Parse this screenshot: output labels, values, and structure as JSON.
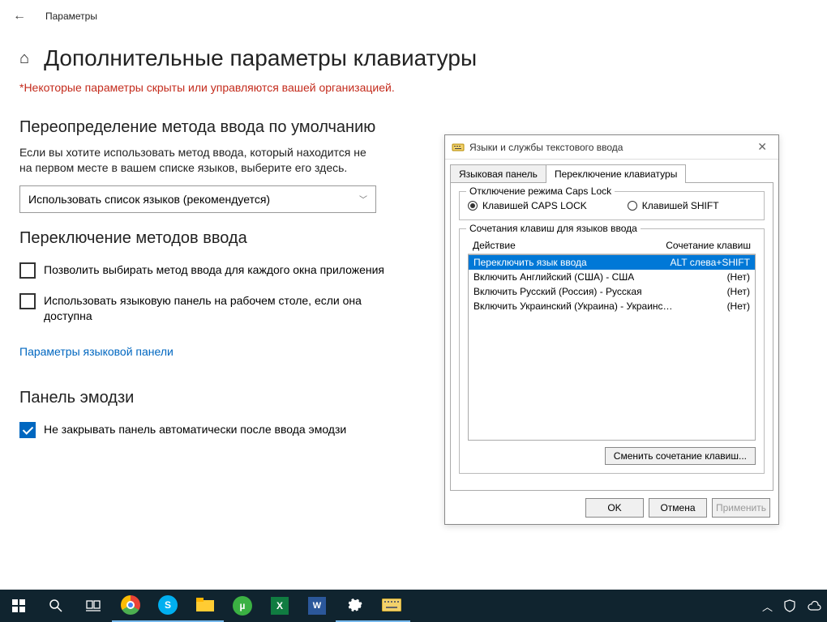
{
  "topbar": {
    "back": "←",
    "title": "Параметры"
  },
  "page": {
    "title": "Дополнительные параметры клавиатуры",
    "warning": "*Некоторые параметры скрыты или управляются вашей организацией.",
    "section_override": "Переопределение метода ввода по умолчанию",
    "override_desc": "Если вы хотите использовать метод ввода, который находится не на первом месте в вашем списке языков, выберите его здесь.",
    "dropdown_value": "Использовать список языков (рекомендуется)",
    "section_switch": "Переключение методов ввода",
    "chk1": "Позволить выбирать метод ввода для каждого окна приложения",
    "chk2": "Использовать языковую панель на рабочем столе, если она доступна",
    "link": "Параметры языковой панели",
    "section_emoji": "Панель эмодзи",
    "chk3": "Не закрывать панель автоматически после ввода эмодзи"
  },
  "dialog": {
    "title": "Языки и службы текстового ввода",
    "tabs": [
      "Языковая панель",
      "Переключение клавиатуры"
    ],
    "group_caps": "Отключение режима Caps Lock",
    "radio1": "Клавишей CAPS LOCK",
    "radio2": "Клавишей SHIFT",
    "group_hotkeys": "Сочетания клавиш для языков ввода",
    "col_action": "Действие",
    "col_keys": "Сочетание клавиш",
    "rows": [
      {
        "action": "Переключить язык ввода",
        "keys": "ALT слева+SHIFT",
        "sel": true
      },
      {
        "action": "Включить Английский (США) - США",
        "keys": "(Нет)"
      },
      {
        "action": "Включить Русский (Россия) - Русская",
        "keys": "(Нет)"
      },
      {
        "action": "Включить Украинский (Украина) - Украинская (расшир…",
        "keys": "(Нет)"
      }
    ],
    "btn_change": "Сменить сочетание клавиш...",
    "btn_ok": "OK",
    "btn_cancel": "Отмена",
    "btn_apply": "Применить"
  }
}
